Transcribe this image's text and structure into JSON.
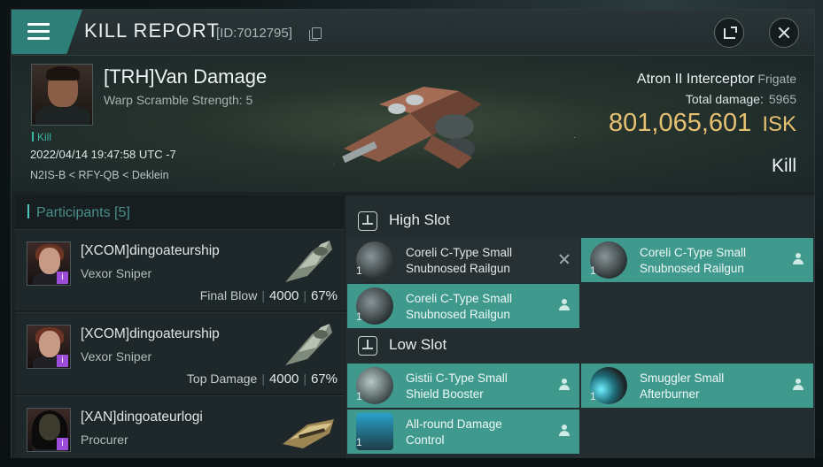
{
  "header": {
    "title": "KILL REPORT",
    "id_text": "[ID:7012795]"
  },
  "victim": {
    "name": "[TRH]Van Damage",
    "warp_scramble": "Warp Scramble Strength: 5",
    "kill_tag": "Kill",
    "datetime": "2022/04/14 19:47:58 UTC -7",
    "location": "N2IS-B < RFY-QB < Deklein",
    "ship_name": "Atron II Interceptor",
    "ship_class": "Frigate",
    "total_damage_label": "Total damage:",
    "total_damage": "5965",
    "isk_value": "801,065,601",
    "isk_unit": "ISK",
    "result": "Kill"
  },
  "participants": {
    "title": "Participants [5]",
    "items": [
      {
        "name": "[XCOM]dingoateurship",
        "ship": "Vexor Sniper",
        "role": "Final Blow",
        "damage": "4000",
        "percent": "67%",
        "badge": "i"
      },
      {
        "name": "[XCOM]dingoateurship",
        "ship": "Vexor Sniper",
        "role": "Top Damage",
        "damage": "4000",
        "percent": "67%",
        "badge": "i"
      },
      {
        "name": "[XAN]dingoateurlogi",
        "ship": "Procurer",
        "role": "",
        "damage": "",
        "percent": "",
        "badge": "i"
      }
    ]
  },
  "slots": {
    "high": {
      "title": "High Slot",
      "modules": [
        {
          "name": "Coreli C-Type Small Snubnosed Railgun",
          "qty": "1",
          "state": "destroyed"
        },
        {
          "name": "Coreli C-Type Small Snubnosed Railgun",
          "qty": "1",
          "state": "dropped"
        },
        {
          "name": "Coreli C-Type Small Snubnosed Railgun",
          "qty": "1",
          "state": "dropped"
        }
      ]
    },
    "low": {
      "title": "Low Slot",
      "modules": [
        {
          "name": "Gistii C-Type Small Shield Booster",
          "qty": "1",
          "state": "dropped"
        },
        {
          "name": "Smuggler Small Afterburner",
          "qty": "1",
          "state": "dropped"
        },
        {
          "name": "All-round Damage Control",
          "qty": "1",
          "state": "dropped"
        }
      ]
    }
  },
  "colors": {
    "accent": "#3f9a8d",
    "isk": "#e6c172",
    "badge": "#9b4cd9"
  }
}
